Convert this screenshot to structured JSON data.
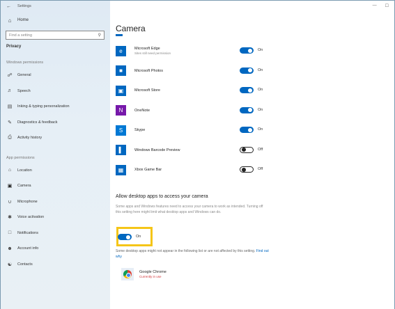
{
  "window": {
    "title": "Settings",
    "controls": [
      "—",
      "☐"
    ]
  },
  "sidebar": {
    "back_glyph": "←",
    "home": {
      "label": "Home",
      "icon": "home-icon"
    },
    "search_placeholder": "Find a setting",
    "category": "Privacy",
    "sections": [
      {
        "heading": "Windows permissions",
        "items": [
          {
            "label": "General",
            "icon": "lock-icon"
          },
          {
            "label": "Speech",
            "icon": "speech-icon"
          },
          {
            "label": "Inking & typing personalization",
            "icon": "inking-icon"
          },
          {
            "label": "Diagnostics & feedback",
            "icon": "diagnostics-icon"
          },
          {
            "label": "Activity history",
            "icon": "activity-icon"
          }
        ]
      },
      {
        "heading": "App permissions",
        "items": [
          {
            "label": "Location",
            "icon": "location-icon"
          },
          {
            "label": "Camera",
            "icon": "camera-icon",
            "selected": true
          },
          {
            "label": "Microphone",
            "icon": "microphone-icon"
          },
          {
            "label": "Voice activation",
            "icon": "voice-icon"
          },
          {
            "label": "Notifications",
            "icon": "notifications-icon"
          },
          {
            "label": "Account info",
            "icon": "account-icon"
          },
          {
            "label": "Contacts",
            "icon": "contacts-icon"
          }
        ]
      }
    ]
  },
  "main": {
    "title": "Camera",
    "apps": [
      {
        "name": "Microsoft Edge",
        "sub": "Sites still need permission",
        "state": "On",
        "on": true,
        "icon_color": "#0067c0",
        "icon": "edge-icon",
        "glyph": "e"
      },
      {
        "name": "Microsoft Photos",
        "sub": "",
        "state": "On",
        "on": true,
        "icon_color": "#0067c0",
        "icon": "photos-icon",
        "glyph": "■"
      },
      {
        "name": "Microsoft Store",
        "sub": "",
        "state": "On",
        "on": true,
        "icon_color": "#0067c0",
        "icon": "store-icon",
        "glyph": "▣"
      },
      {
        "name": "OneNote",
        "sub": "",
        "state": "On",
        "on": true,
        "icon_color": "#7719aa",
        "icon": "onenote-icon",
        "glyph": "N"
      },
      {
        "name": "Skype",
        "sub": "",
        "state": "On",
        "on": true,
        "icon_color": "#0078d4",
        "icon": "skype-icon",
        "glyph": "S"
      },
      {
        "name": "Windows Barcode Preview",
        "sub": "",
        "state": "Off",
        "on": false,
        "icon_color": "#0067c0",
        "icon": "barcode-icon",
        "glyph": "▌"
      },
      {
        "name": "Xbox Game Bar",
        "sub": "",
        "state": "Off",
        "on": false,
        "icon_color": "#0067c0",
        "icon": "xbox-icon",
        "glyph": "▦"
      }
    ],
    "desktop": {
      "title": "Allow desktop apps to access your camera",
      "description": "Some apps and Windows features need to access your camera to work as intended. Turning off this setting here might limit what desktop apps and Windows can do.",
      "toggle_state": "On",
      "note": "Some desktop apps might not appear in the following list or are not affected by this setting.",
      "link": "Find out why",
      "apps": [
        {
          "name": "Google Chrome",
          "status": "Currently in use"
        }
      ]
    }
  }
}
